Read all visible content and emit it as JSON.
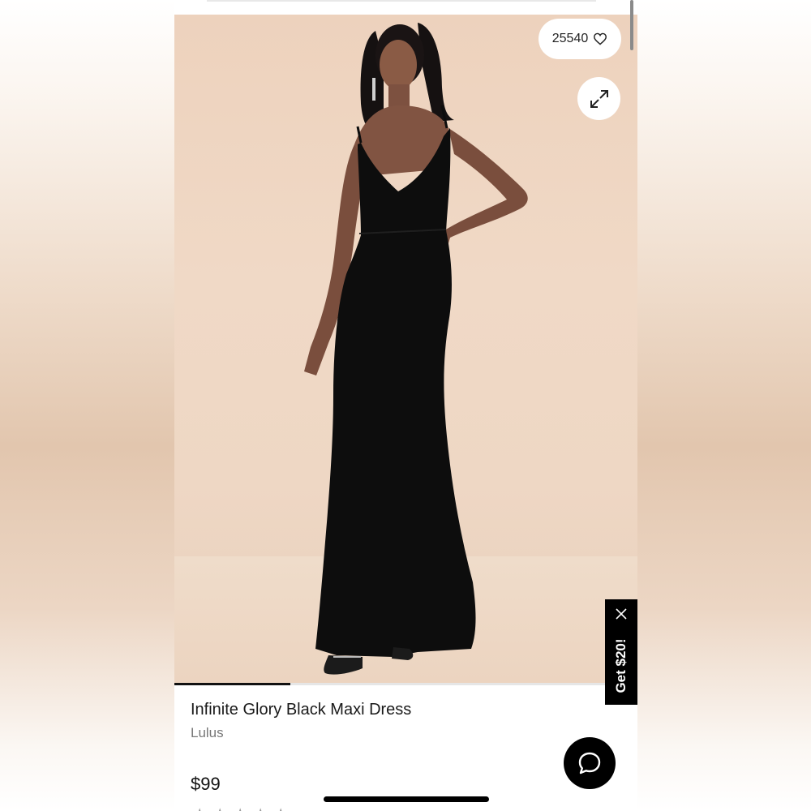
{
  "product": {
    "title": "Infinite Glory Black Maxi Dress",
    "brand": "Lulus",
    "price": "$99",
    "likes": "25540"
  },
  "gallery": {
    "progress_fraction": 0.25
  },
  "promo": {
    "label": "Get $20!"
  },
  "icons": {
    "likes": "heart-outline-icon",
    "expand": "expand-arrows-icon",
    "promo_close": "close-icon",
    "chat": "chat-bubble-icon"
  },
  "colors": {
    "accent": "#000000",
    "photo_background": "#edd2bd",
    "dress": "#0d0d0d"
  }
}
